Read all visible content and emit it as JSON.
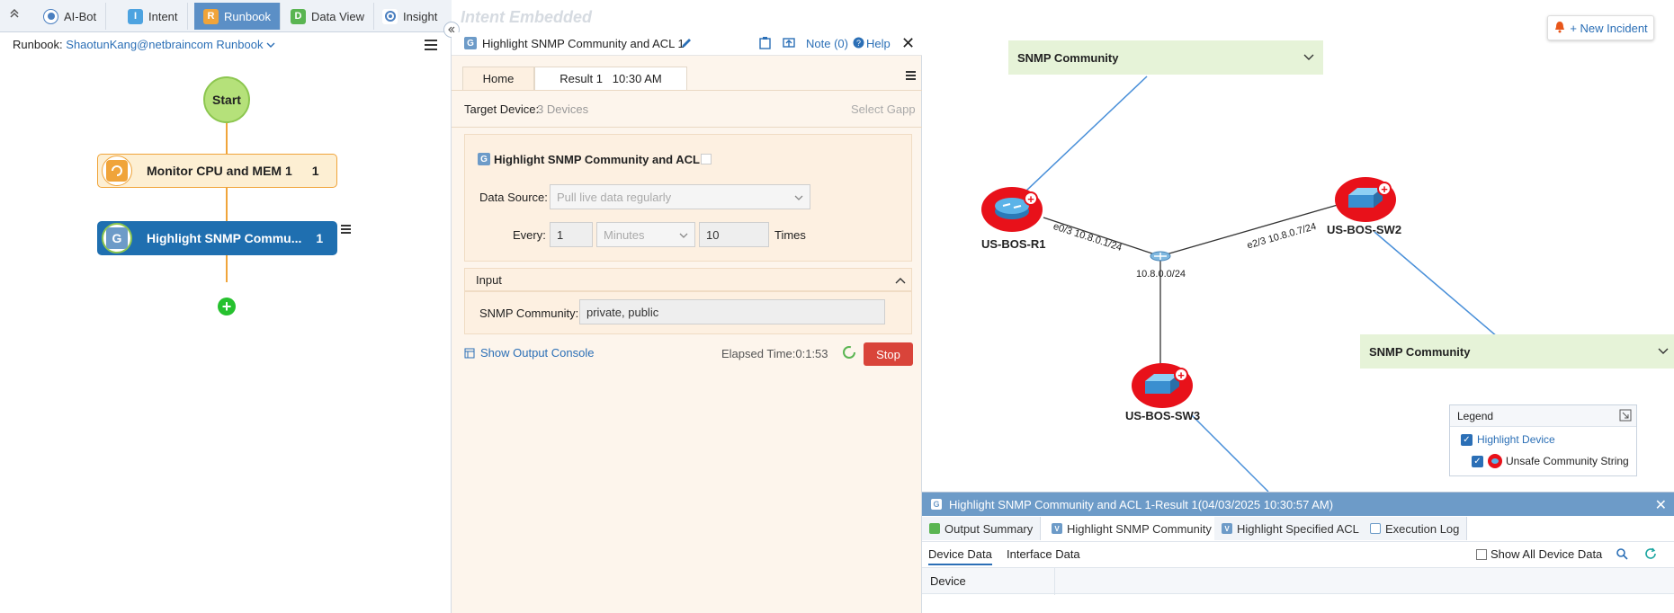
{
  "top_tabs": [
    {
      "label": "AI-Bot",
      "icon": "ai-bot-icon"
    },
    {
      "label": "Intent",
      "icon": "intent-icon",
      "icon_text": "I"
    },
    {
      "label": "Runbook",
      "icon": "runbook-icon",
      "icon_text": "R"
    },
    {
      "label": "Data View",
      "icon": "data-view-icon",
      "icon_text": "D"
    },
    {
      "label": "Insight",
      "icon": "insight-icon"
    }
  ],
  "runbook": {
    "prefix": "Runbook:",
    "owner_link": "ShaotunKang@netbraincom Runbook",
    "start_label": "Start",
    "nodes": [
      {
        "label": "Monitor CPU and MEM 1",
        "count": "1"
      },
      {
        "label": "Highlight SNMP Commu...",
        "count": "1"
      }
    ]
  },
  "watermark": "Intent Embedded",
  "detail": {
    "title": "Highlight SNMP Community and ACL 1",
    "icon_text": "G",
    "note": "Note (0)",
    "help": "Help",
    "tabs": [
      "Home",
      "Result 1   10:30 AM"
    ],
    "target_label": "Target Device:",
    "target_value": "3 Devices",
    "select_gapp": "Select Gapp",
    "card_title": "Highlight SNMP Community and ACL",
    "data_source_label": "Data Source:",
    "data_source_value": "Pull live data regularly",
    "every_label": "Every:",
    "every_value": "1",
    "unit_value": "Minutes",
    "times_value": "10",
    "times_label": "Times",
    "input_section": "Input",
    "snmp_label": "SNMP Community:",
    "snmp_value": "private, public",
    "output_console": "Show Output Console",
    "elapsed": "Elapsed Time:0:1:53",
    "stop": "Stop"
  },
  "map": {
    "snmp_boxes": [
      "SNMP Community",
      "SNMP Community"
    ],
    "devices": [
      "US-BOS-R1",
      "US-BOS-SW2",
      "US-BOS-SW3"
    ],
    "link_labels": [
      "e0/3 10.8.0.1/24",
      "e2/3 10.8.0.7/24"
    ],
    "subnet": "10.8.0.0/24",
    "new_incident": "+ New Incident",
    "legend": {
      "title": "Legend",
      "items": [
        "Highlight Device",
        "Unsafe Community String"
      ]
    }
  },
  "result_panel": {
    "title": "Highlight SNMP Community and ACL 1-Result 1(04/03/2025 10:30:57 AM)",
    "tabs": [
      "Output Summary",
      "Highlight SNMP Community",
      "Highlight Specified ACL",
      "Execution Log"
    ],
    "subtabs": [
      "Device Data",
      "Interface Data"
    ],
    "show_all": "Show All Device Data",
    "column_device": "Device"
  },
  "colors": {
    "accent": "#5b8fc6",
    "highlight": "#e8111a",
    "stop": "#d9443a",
    "node_active": "#1f6fb0"
  }
}
